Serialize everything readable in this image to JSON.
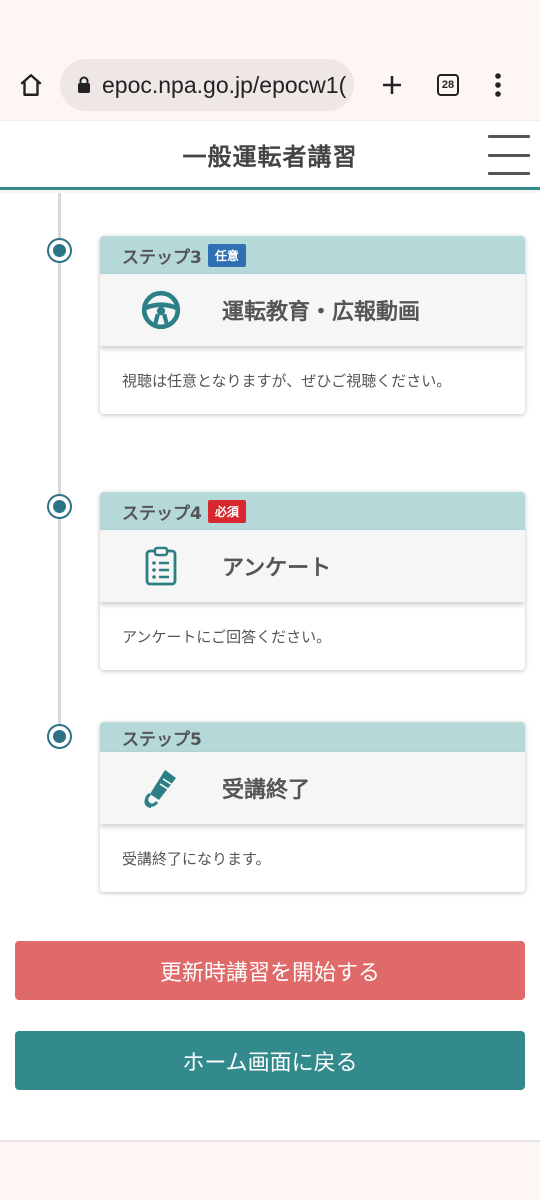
{
  "browser": {
    "url": "epoc.npa.go.jp/epocw1(",
    "tab_count": "28"
  },
  "header": {
    "title": "一般運転者講習"
  },
  "steps": [
    {
      "label": "ステップ3",
      "badge": "任意",
      "badge_color": "#2f6fb3",
      "icon": "steering-wheel-icon",
      "title": "運転教育・広報動画",
      "description": "視聴は任意となりますが、ぜひご視聴ください。"
    },
    {
      "label": "ステップ4",
      "badge": "必須",
      "badge_color": "#d7282f",
      "icon": "clipboard-list-icon",
      "title": "アンケート",
      "description": "アンケートにご回答ください。"
    },
    {
      "label": "ステップ5",
      "badge": "",
      "icon": "diploma-scroll-icon",
      "title": "受講終了",
      "description": "受講終了になります。"
    }
  ],
  "buttons": {
    "start": "更新時講習を開始する",
    "home": "ホーム画面に戻る"
  },
  "colors": {
    "accent": "#338a8c",
    "step_header": "#b5d8d8",
    "start_button": "#e0696a"
  }
}
